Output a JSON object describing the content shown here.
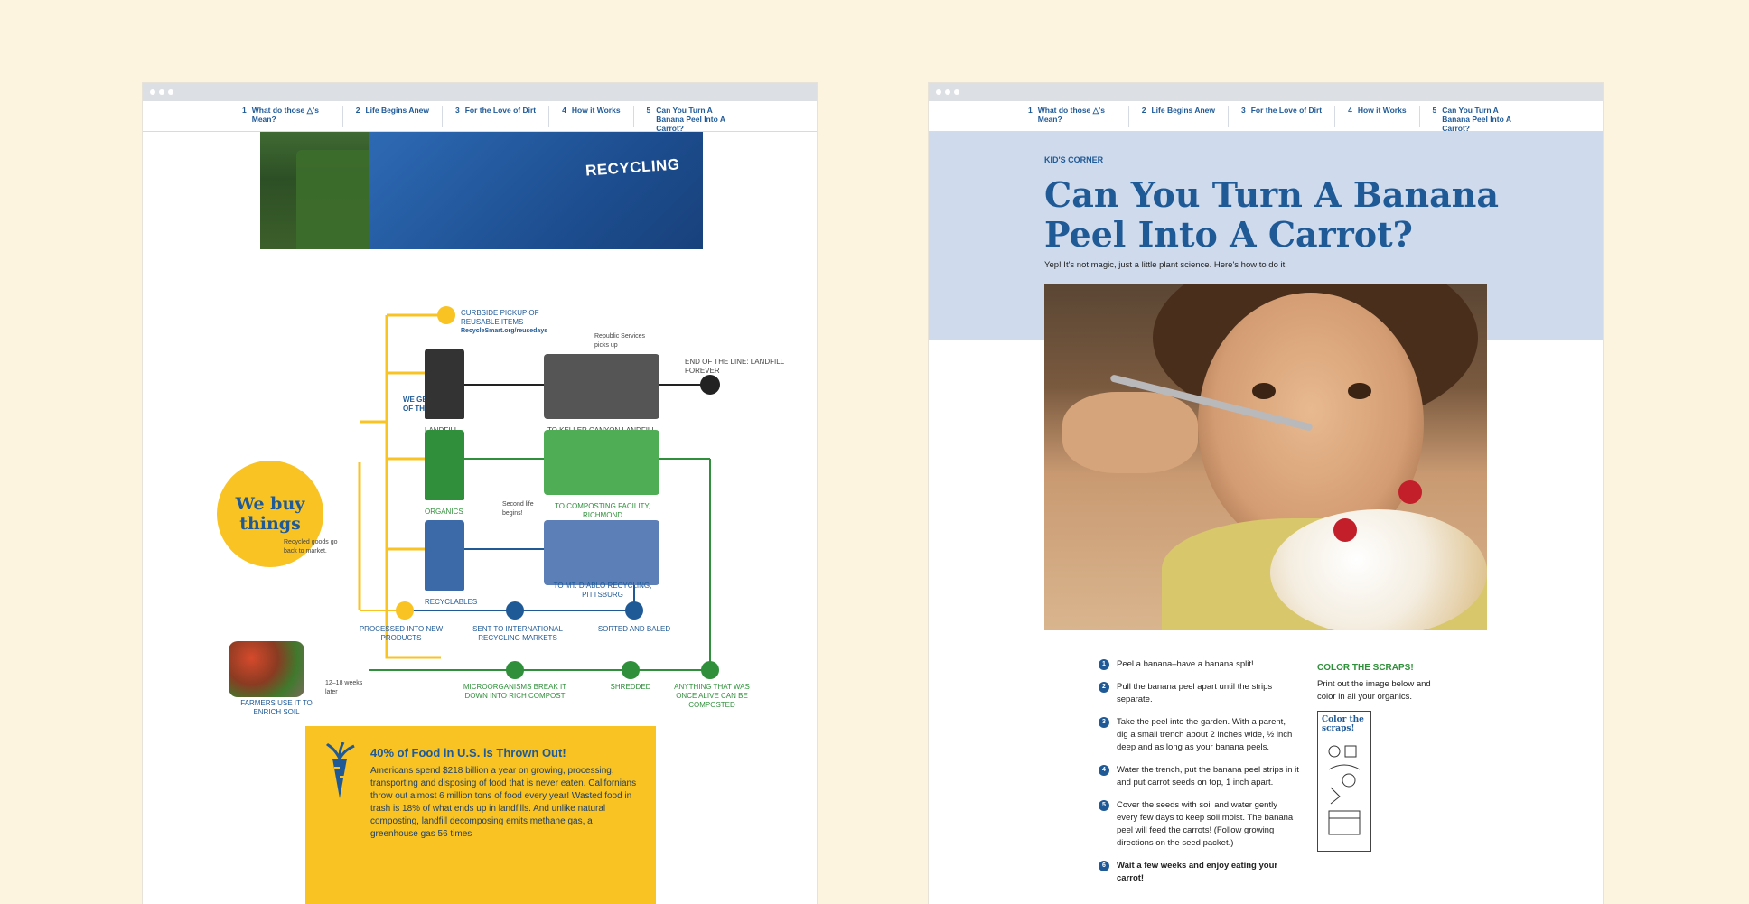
{
  "nav": [
    {
      "num": "1",
      "label": "What do those △'s Mean?"
    },
    {
      "num": "2",
      "label": "Life Begins Anew"
    },
    {
      "num": "3",
      "label": "For the Love of Dirt"
    },
    {
      "num": "4",
      "label": "How it Works"
    },
    {
      "num": "5",
      "label": "Can You Turn A Banana Peel Into A Carrot?"
    }
  ],
  "left": {
    "photo_text": "RECYCLING",
    "diagram": {
      "center": "We buy things",
      "we_get_rid": "WE GET RID OF THINGS!",
      "curbside": "CURBSIDE PICKUP OF REUSABLE ITEMS",
      "curbside_link": "RecycleSmart.org/reusedays",
      "republic_note": "Republic Services picks up",
      "end_line": "END OF THE LINE: LANDFILL FOREVER",
      "landfill": "LANDFILL",
      "to_keller": "TO KELLER CANYON LANDFILL, PITTSBURG",
      "organics": "ORGANICS",
      "second_life": "Second life begins!",
      "to_composting": "TO COMPOSTING FACILITY, RICHMOND",
      "recyclables": "RECYCLABLES",
      "to_diablo": "TO MT. DIABLO RECYCLING, PITTSBURG",
      "recycled_goods": "Recycled goods go back to market.",
      "processed": "PROCESSED INTO NEW PRODUCTS",
      "sent_intl": "SENT TO INTERNATIONAL RECYCLING MARKETS",
      "sorted": "SORTED AND BALED",
      "farmers": "FARMERS USE IT TO ENRICH SOIL",
      "weeks": "12–18 weeks later",
      "microorganisms": "MICROORGANISMS BREAK IT DOWN INTO RICH COMPOST",
      "shredded": "SHREDDED",
      "anything_alive": "ANYTHING THAT WAS ONCE ALIVE CAN BE COMPOSTED"
    },
    "callout": {
      "title": "40% of Food in U.S. is Thrown Out!",
      "body": "Americans spend $218 billion a year on growing, processing, transporting and disposing of food that is never eaten. Californians throw out almost 6 million tons of food every year! Wasted food in trash is 18% of what ends up in landfills. And unlike natural composting, landfill decomposing emits methane gas, a greenhouse gas 56 times"
    }
  },
  "right": {
    "kicker": "KID'S CORNER",
    "title": "Can You Turn A Banana Peel Into A Carrot?",
    "subtitle": "Yep! It's not magic, just a little plant science. Here's how to do it.",
    "steps": [
      {
        "num": "1",
        "text": "Peel a banana–have a banana split!"
      },
      {
        "num": "2",
        "text": "Pull the banana peel apart until the strips separate."
      },
      {
        "num": "3",
        "text": "Take the peel into the garden. With a parent, dig a small trench about 2 inches wide, ½ inch deep and as long as your banana peels."
      },
      {
        "num": "4",
        "text": "Water the trench, put the banana peel strips in it and put carrot seeds on top, 1 inch apart."
      },
      {
        "num": "5",
        "text": "Cover the seeds with soil and water gently every few days to keep soil moist. The banana peel will feed the carrots! (Follow growing directions on the seed packet.)"
      },
      {
        "num": "6",
        "text": "Wait a few weeks and enjoy eating your carrot!"
      }
    ],
    "color_title": "COLOR THE SCRAPS!",
    "color_text": "Print out the image below and color in all your organics.",
    "coloring_label": "Color the scraps!"
  },
  "colors": {
    "background": "#fdf4e0",
    "blue": "#1f5a97",
    "green": "#2f8f3a",
    "yellow": "#f9c324"
  }
}
